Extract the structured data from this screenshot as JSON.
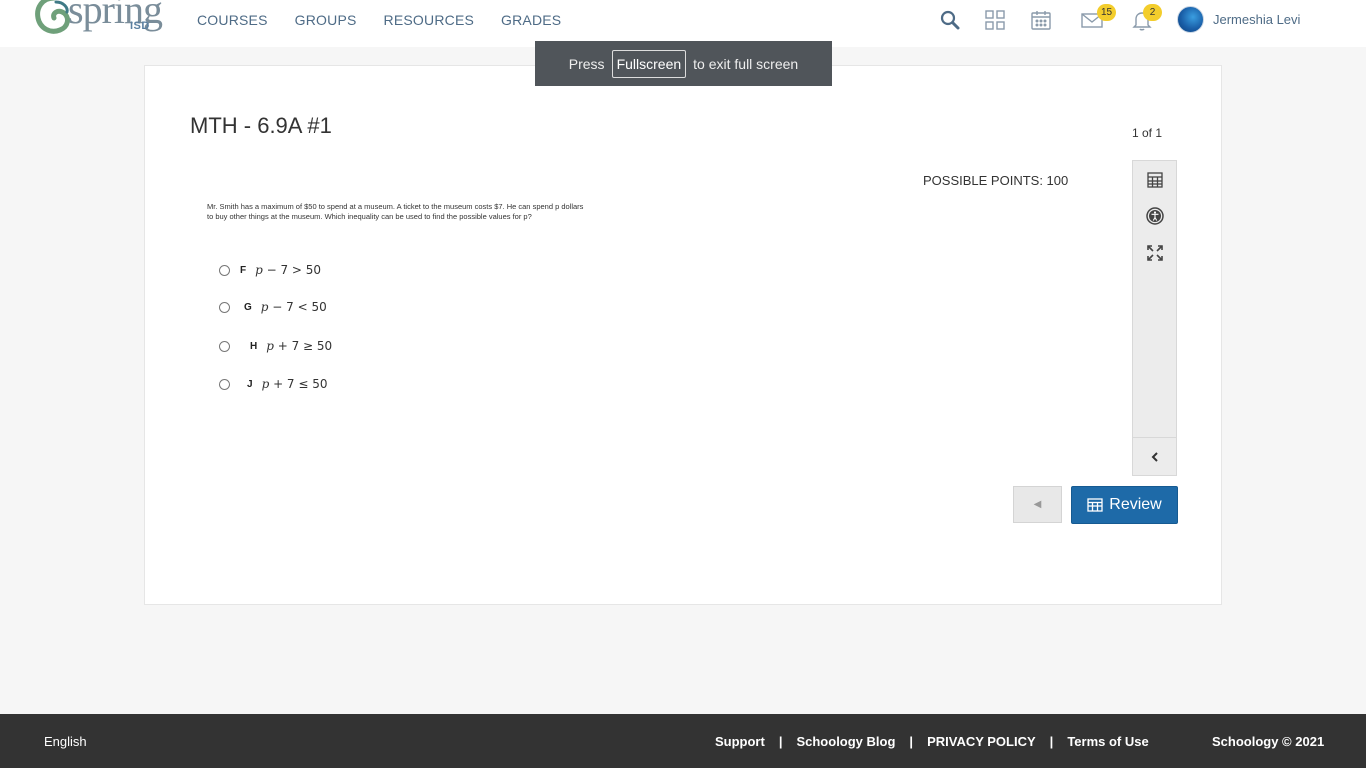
{
  "header": {
    "logo_word": "spring",
    "logo_sub": "ISD",
    "nav": [
      "COURSES",
      "GROUPS",
      "RESOURCES",
      "GRADES"
    ],
    "icons": [
      "search-icon",
      "apps-grid-icon",
      "calendar-icon",
      "mail-icon",
      "bell-icon"
    ],
    "mail_count": "15",
    "notifications_count": "2",
    "user_name": "Jermeshia Levi",
    "accent_color": "#4e6b86",
    "badge_color": "#f3cd2c"
  },
  "toast": {
    "prefix": "Press",
    "key": "Fullscreen",
    "suffix": "to exit full screen"
  },
  "assessment": {
    "title": "MTH - 6.9A #1",
    "page_counter": "1 of 1",
    "possible_points": "POSSIBLE POINTS: 100",
    "question_text": "Mr. Smith has a maximum of $50 to spend at a museum. A ticket to the museum costs $7. He can spend p dollars to buy other things at the museum. Which inequality can be used to find the possible values for p?",
    "choices": [
      {
        "letter": "F",
        "var": "p",
        "rest": " − 7 > 50"
      },
      {
        "letter": "G",
        "var": "p",
        "rest": " − 7 < 50"
      },
      {
        "letter": "H",
        "var": "p",
        "rest": " + 7 ≥ 50"
      },
      {
        "letter": "J",
        "var": "p",
        "rest": " + 7 ≤ 50"
      }
    ],
    "tools": [
      "calculator-icon",
      "accessibility-icon",
      "expand-icon"
    ],
    "review_label": "Review",
    "primary_color": "#1e6aa8"
  },
  "footer": {
    "language": "English",
    "links": [
      "Support",
      "Schoology Blog",
      "PRIVACY POLICY",
      "Terms of Use"
    ],
    "separator": "|",
    "copyright": "Schoology © 2021"
  }
}
